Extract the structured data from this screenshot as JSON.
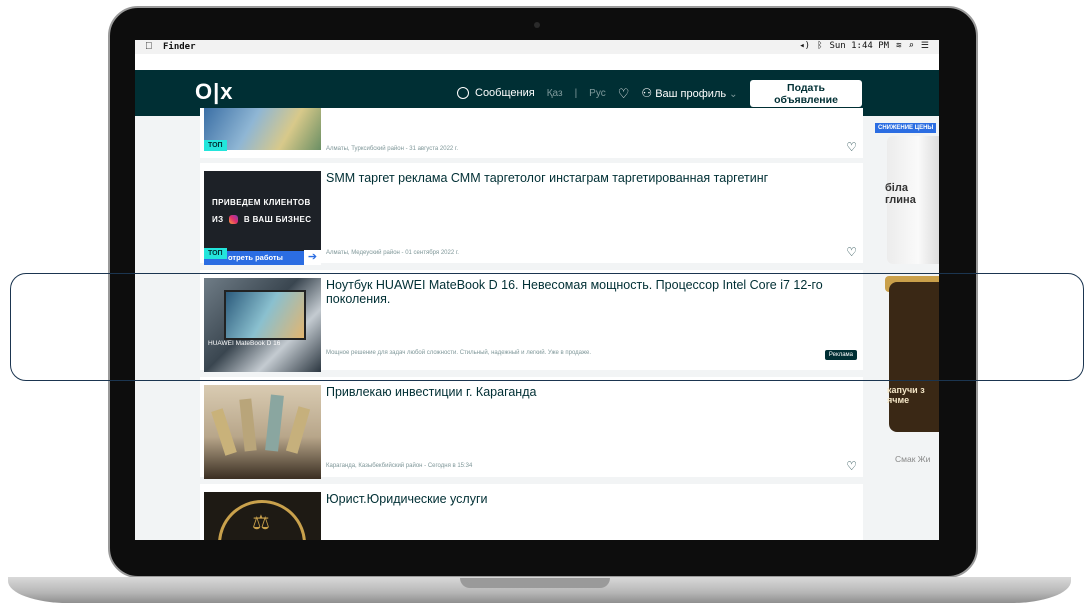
{
  "menubar": {
    "apple": "",
    "app": "Finder",
    "clock": "Sun 1:44 PM"
  },
  "header": {
    "logo": "O|x",
    "messages": "Сообщения",
    "lang_kz": "Қаз",
    "lang_sep": "|",
    "lang_ru": "Рус",
    "profile": "Ваш профиль",
    "post_button": "Подать объявление"
  },
  "listings": [
    {
      "title": "",
      "meta": "Алматы, Турксибский район - 31 августа 2022 г.",
      "badge": "ТОП"
    },
    {
      "title": "SMM таргет реклама СММ таргетолог инстаграм таргетированная таргетинг",
      "meta": "Алматы, Медеуский район - 01 сентября 2022 г.",
      "badge": "ТОП",
      "thumb_line1": "ПРИВЕДЕМ КЛИЕНТОВ",
      "thumb_line2": "ИЗ",
      "thumb_line3": "В ВАШ БИЗНЕС",
      "thumb_strip": "отреть работы"
    },
    {
      "title": "Ноутбук HUAWEI MateBook D 16. Невесомая мощность. Процессор Intel Core i7 12-го поколения.",
      "meta": "Мощное решение для задач любой сложности. Стильный, надежный и легкий. Уже в продаже.",
      "ad_badge": "Реклама",
      "thumb_brand": "HUAWEI MateBook D 16"
    },
    {
      "title": "Привлекаю инвестиции г. Караганда",
      "meta": "Караганда, Казыбекбийский район - Сегодня в 15:34"
    },
    {
      "title": "Юрист.Юридические услуги"
    }
  ],
  "side_ad": {
    "badge": "СНИЖЕНИЕ ЦЕНЫ",
    "pack_text": "біла глина",
    "jar_text": "капучи з ячме",
    "caption": "Смак Жи"
  },
  "colors": {
    "header_bg": "#002f34",
    "top_badge": "#23e5db",
    "page_bg": "#f2f4f5"
  }
}
